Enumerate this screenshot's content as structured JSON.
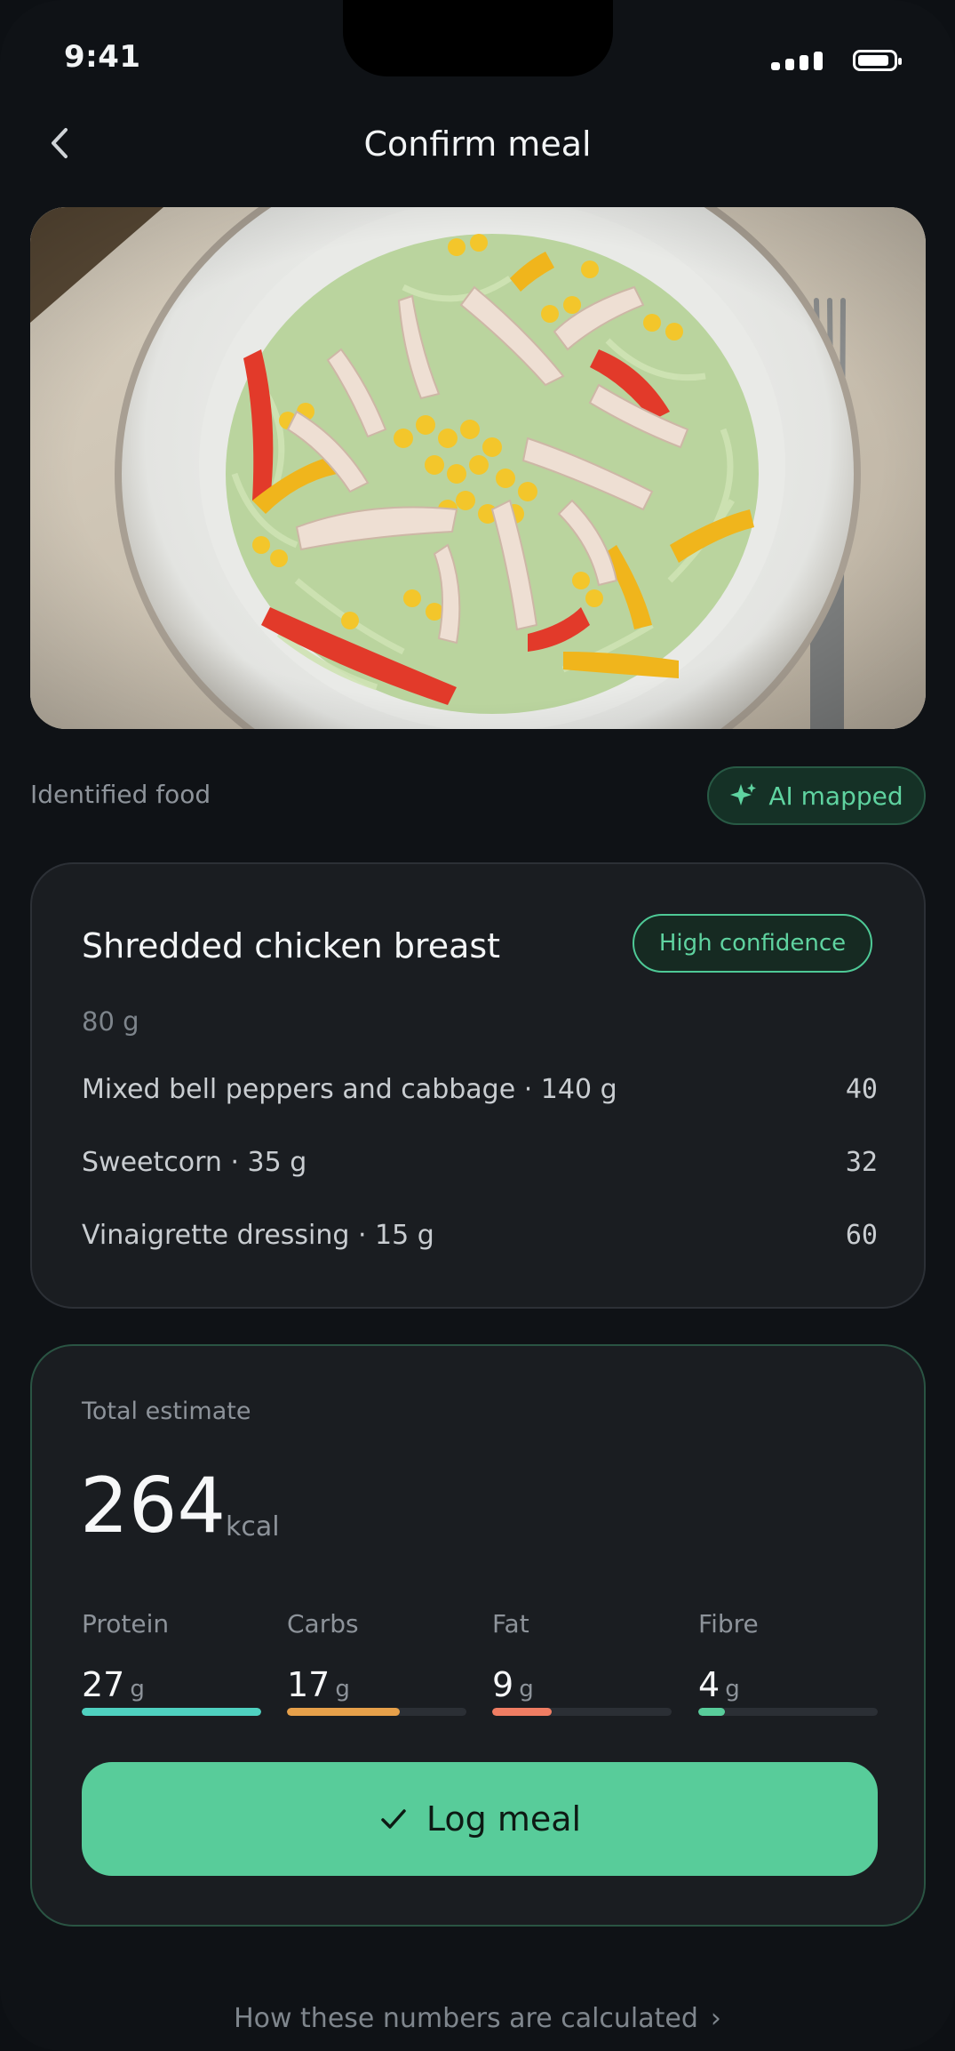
{
  "status": {
    "time": "9:41"
  },
  "nav": {
    "title": "Confirm meal",
    "back_icon": "chevron-left-icon"
  },
  "identified": {
    "label": "Identified food",
    "chip": "AI mapped",
    "chip_icon": "sparkle-icon"
  },
  "food": {
    "name": "Shredded chicken breast",
    "confidence": "High confidence",
    "weight": "80 g",
    "items": [
      {
        "label": "Mixed bell peppers and cabbage · 140 g",
        "kcal": "40"
      },
      {
        "label": "Sweetcorn · 35 g",
        "kcal": "32"
      },
      {
        "label": "Vinaigrette dressing · 15 g",
        "kcal": "60"
      }
    ]
  },
  "total": {
    "label": "Total estimate",
    "kcal": "264",
    "unit": "kcal",
    "macros": [
      {
        "name": "Protein",
        "value": "27",
        "unit": "g",
        "fill": 1.0,
        "color": "#4fd1c0"
      },
      {
        "name": "Carbs",
        "value": "17",
        "unit": "g",
        "fill": 0.63,
        "color": "#e6a04a"
      },
      {
        "name": "Fat",
        "value": "9",
        "unit": "g",
        "fill": 0.33,
        "color": "#ef7d63"
      },
      {
        "name": "Fibre",
        "value": "4",
        "unit": "g",
        "fill": 0.15,
        "color": "#58cc9a"
      }
    ],
    "log_button": "Log meal"
  },
  "footer": {
    "link": "How these numbers are calculated"
  },
  "colors": {
    "accent": "#58cc9a",
    "background": "#0f1216",
    "card": "#1a1d21"
  }
}
